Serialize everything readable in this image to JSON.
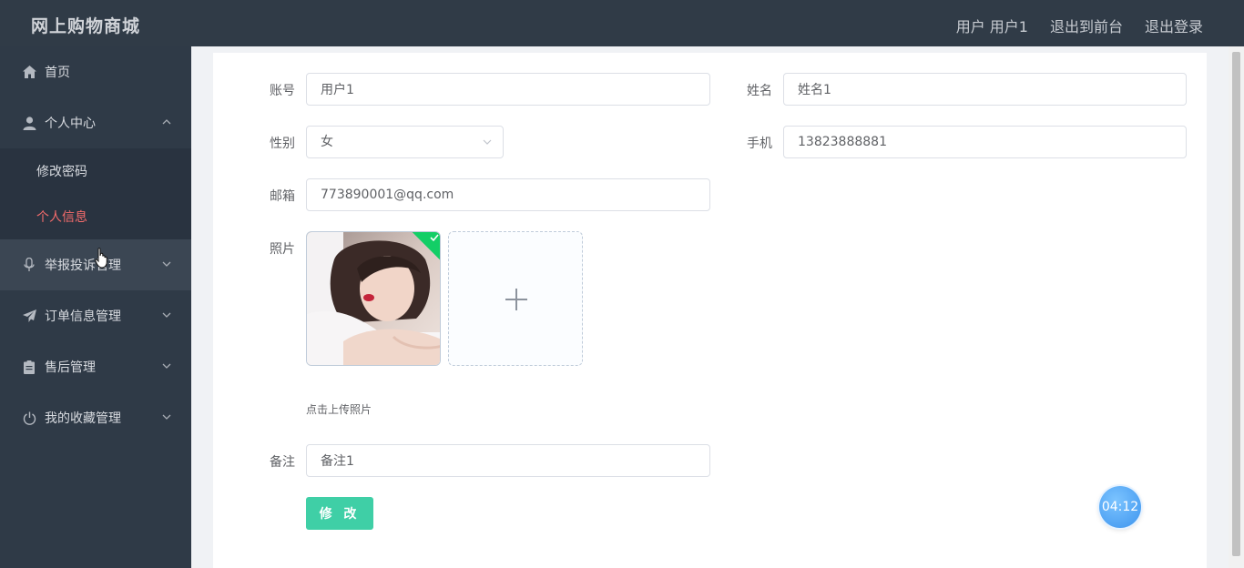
{
  "header": {
    "title": "网上购物商城",
    "user_label": "用户 用户1",
    "front_link": "退出到前台",
    "logout_link": "退出登录"
  },
  "sidebar": {
    "items": [
      {
        "label": "首页",
        "icon": "home-icon"
      },
      {
        "label": "个人中心",
        "icon": "user-icon",
        "expanded": true,
        "children": [
          {
            "label": "修改密码"
          },
          {
            "label": "个人信息",
            "active": true
          }
        ]
      },
      {
        "label": "举报投诉管理",
        "icon": "microphone-icon"
      },
      {
        "label": "订单信息管理",
        "icon": "paper-plane-icon"
      },
      {
        "label": "售后管理",
        "icon": "clipboard-icon"
      },
      {
        "label": "我的收藏管理",
        "icon": "power-icon"
      }
    ]
  },
  "form": {
    "account": {
      "label": "账号",
      "value": "用户1"
    },
    "name": {
      "label": "姓名",
      "value": "姓名1"
    },
    "gender": {
      "label": "性别",
      "value": "女"
    },
    "phone": {
      "label": "手机",
      "value": "13823888881"
    },
    "email": {
      "label": "邮箱",
      "value": "773890001@qq.com"
    },
    "photo": {
      "label": "照片",
      "tip": "点击上传照片"
    },
    "remark": {
      "label": "备注",
      "value": "备注1"
    },
    "submit_label": "修 改"
  },
  "timer": "04:12",
  "colors": {
    "header_bg": "#303b47",
    "sidebar_bg": "#2f3a47",
    "active_text": "#f56c6c",
    "submit_button": "#3fcfa6",
    "success_check": "#13ce66",
    "timer_bg": "#3d94ee"
  }
}
